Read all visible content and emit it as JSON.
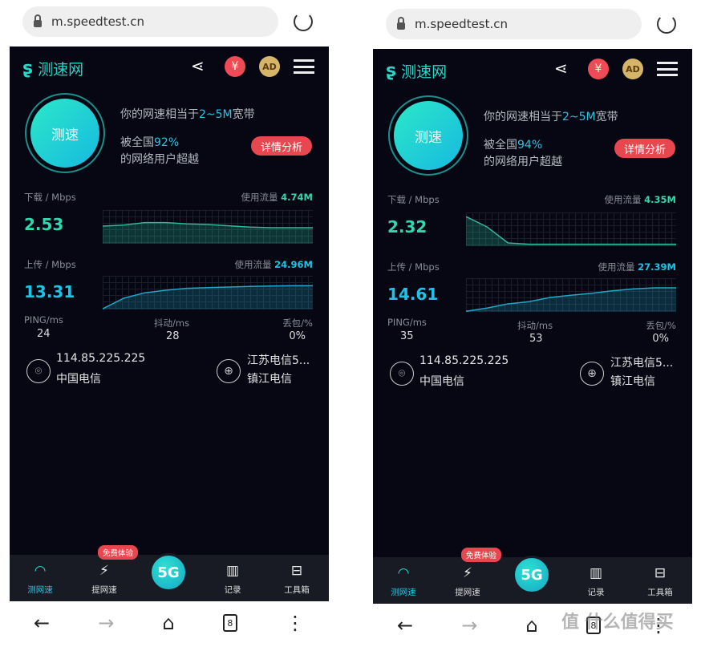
{
  "watermark": "值 什么值得买",
  "colors": {
    "accent": "#27d6c7",
    "download": "#2fd9b0",
    "upload": "#1fc3e8",
    "button": "#e9474f",
    "background": "#060713"
  },
  "phones": [
    {
      "url": "m.speedtest.cn",
      "logo": "测速网",
      "icons": {
        "share": "share-icon",
        "yen": "¥",
        "ad": "AD",
        "menu": "menu-icon"
      },
      "test_button": "测速",
      "equiv_prefix": "你的网速相当于",
      "equiv_value": "2~5M",
      "equiv_suffix": "宽带",
      "beat_prefix": "被全国",
      "beat_percent": "92%",
      "beat_suffix": "的网络用户超越",
      "detail_button": "详情分析",
      "download": {
        "label": "下载 / Mbps",
        "value": "2.53",
        "usage_label": "使用流量",
        "usage": "4.74M",
        "curve": [
          0.55,
          0.58,
          0.66,
          0.66,
          0.62,
          0.6,
          0.56,
          0.52,
          0.5,
          0.5,
          0.5
        ]
      },
      "upload": {
        "label": "上传 / Mbps",
        "value": "13.31",
        "usage_label": "使用流量",
        "usage": "24.96M",
        "curve": [
          0.02,
          0.35,
          0.52,
          0.6,
          0.66,
          0.68,
          0.7,
          0.72,
          0.73,
          0.74,
          0.74
        ]
      },
      "ping": {
        "label": "PING/ms",
        "value": "24"
      },
      "jitter": {
        "label": "抖动/ms",
        "value": "28"
      },
      "loss": {
        "label": "丢包/%",
        "value": "0%"
      },
      "ip": "114.85.225.225",
      "isp": "中国电信",
      "server": "江苏电信5...",
      "server_city": "镇江电信",
      "tabs": [
        "测网速",
        "提网速",
        "5G",
        "记录",
        "工具箱"
      ],
      "promo_badge": "免费体验",
      "tab_count": "8"
    },
    {
      "url": "m.speedtest.cn",
      "logo": "测速网",
      "icons": {
        "share": "share-icon",
        "yen": "¥",
        "ad": "AD",
        "menu": "menu-icon"
      },
      "test_button": "测速",
      "equiv_prefix": "你的网速相当于",
      "equiv_value": "2~5M",
      "equiv_suffix": "宽带",
      "beat_prefix": "被全国",
      "beat_percent": "94%",
      "beat_suffix": "的网络用户超越",
      "detail_button": "详情分析",
      "download": {
        "label": "下载 / Mbps",
        "value": "2.32",
        "usage_label": "使用流量",
        "usage": "4.35M",
        "curve": [
          0.92,
          0.6,
          0.1,
          0.06,
          0.06,
          0.06,
          0.06,
          0.06,
          0.06,
          0.06,
          0.06
        ]
      },
      "upload": {
        "label": "上传 / Mbps",
        "value": "14.61",
        "usage_label": "使用流量",
        "usage": "27.39M",
        "curve": [
          0.02,
          0.12,
          0.25,
          0.32,
          0.45,
          0.52,
          0.58,
          0.66,
          0.72,
          0.75,
          0.75
        ]
      },
      "ping": {
        "label": "PING/ms",
        "value": "35"
      },
      "jitter": {
        "label": "抖动/ms",
        "value": "53"
      },
      "loss": {
        "label": "丢包/%",
        "value": "0%"
      },
      "ip": "114.85.225.225",
      "isp": "中国电信",
      "server": "江苏电信5...",
      "server_city": "镇江电信",
      "tabs": [
        "测网速",
        "提网速",
        "5G",
        "记录",
        "工具箱"
      ],
      "promo_badge": "免费体验",
      "tab_count": "8"
    }
  ]
}
